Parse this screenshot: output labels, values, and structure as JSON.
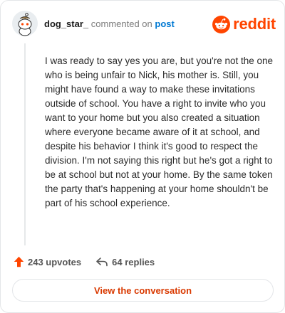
{
  "header": {
    "username": "dog_star_",
    "commented_text": "commented on",
    "post_link": "post",
    "brand": "reddit"
  },
  "comment": {
    "body": "I was ready to say yes you are, but you're not the one who is being unfair to Nick, his mother is. Still, you might have found a way to make these invitations outside of school. You have a right to invite who you want to your home but you also created a situation where everyone became aware of it at school, and despite his behavior I think it's good to respect the division. I'm not saying this right but he's got a right to be at school but not at your home. By the same token the party that's happening at your home shouldn't be part of his school experience."
  },
  "actions": {
    "upvotes": "243 upvotes",
    "replies": "64 replies"
  },
  "cta": {
    "label": "View the conversation"
  },
  "colors": {
    "brand": "#ff4500",
    "link": "#0079d3",
    "cta_text": "#d93900"
  },
  "icons": {
    "upvote": "upvote-arrow-icon",
    "reply": "reply-arrow-icon",
    "brand": "reddit-logo-icon"
  }
}
